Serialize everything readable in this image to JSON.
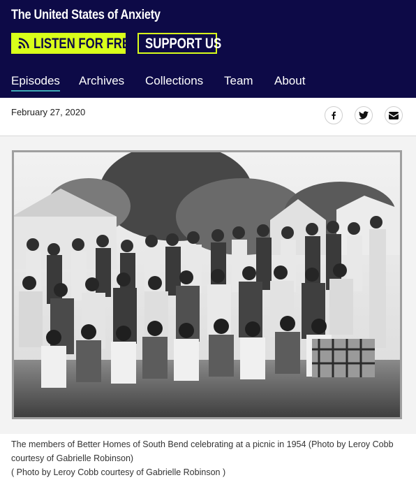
{
  "header": {
    "show_title": "The United States of Anxiety",
    "listen_label": "LISTEN FOR FREE",
    "support_label": "SUPPORT US"
  },
  "nav": {
    "items": [
      "Episodes",
      "Archives",
      "Collections",
      "Team",
      "About"
    ],
    "active": "Episodes"
  },
  "article": {
    "date": "February 27, 2020",
    "share_icons": [
      "facebook-icon",
      "twitter-icon",
      "email-icon"
    ]
  },
  "photo": {
    "caption": "The members of Better Homes of South Bend celebrating at a picnic in 1954 (Photo by Leroy Cobb courtesy of Gabrielle Robinson)",
    "credit": "( Photo by Leroy Cobb courtesy of Gabrielle Robinson )"
  },
  "colors": {
    "header_bg": "#0d0a47",
    "accent": "#d9ff1a",
    "nav_underline": "#3fa9b5"
  }
}
